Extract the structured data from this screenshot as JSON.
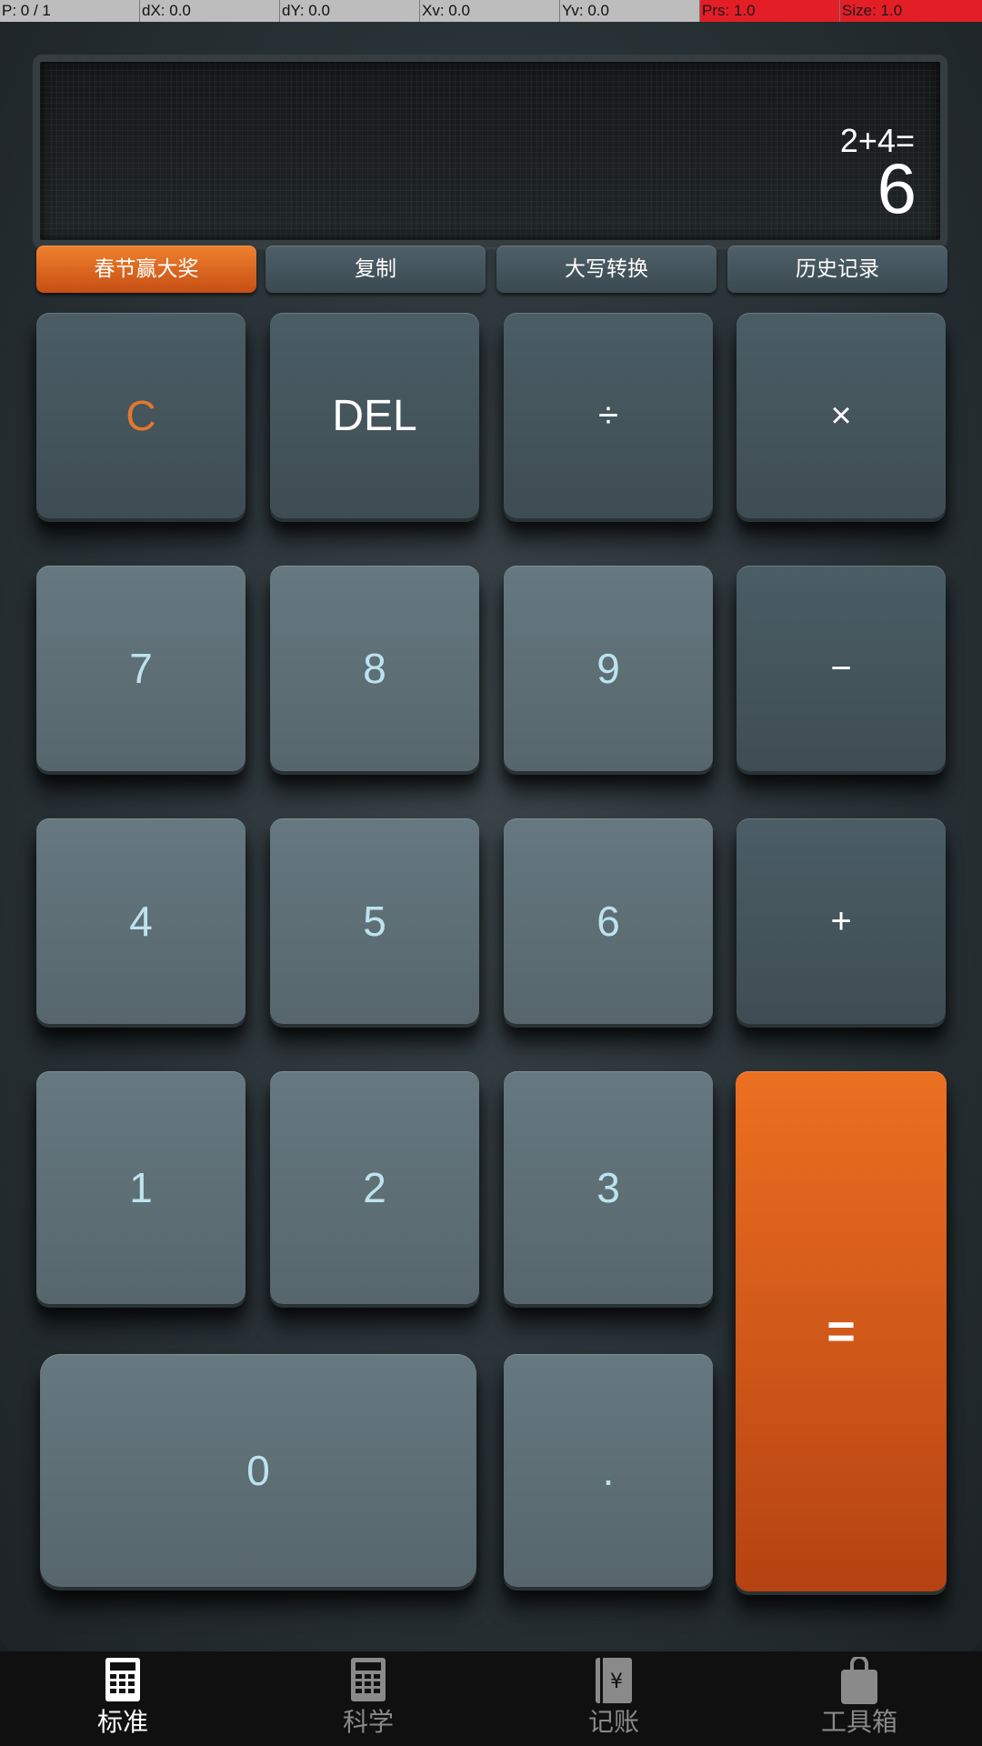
{
  "debug": {
    "p": "P: 0 / 1",
    "dx": "dX: 0.0",
    "dy": "dY: 0.0",
    "xv": "Xv: 0.0",
    "yv": "Yv: 0.0",
    "prs": "Prs: 1.0",
    "size": "Size: 1.0"
  },
  "display": {
    "expression": "2+4=",
    "result": "6"
  },
  "function_buttons": {
    "promo": "春节赢大奖",
    "copy": "复制",
    "uppercase": "大写转换",
    "history": "历史记录"
  },
  "keys": {
    "clear": "C",
    "delete": "DEL",
    "divide": "÷",
    "multiply": "×",
    "seven": "7",
    "eight": "8",
    "nine": "9",
    "minus": "−",
    "four": "4",
    "five": "5",
    "six": "6",
    "plus": "+",
    "one": "1",
    "two": "2",
    "three": "3",
    "equals": "=",
    "zero": "0",
    "dot": "."
  },
  "nav": {
    "standard": "标准",
    "scientific": "科学",
    "accounting": "记账",
    "toolbox": "工具箱",
    "active": "standard"
  },
  "colors": {
    "accent": "#e8702a",
    "key_text": "#bde3ef"
  }
}
